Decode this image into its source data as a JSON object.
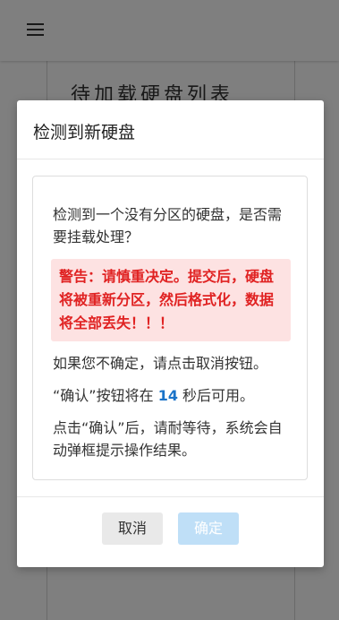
{
  "header": {
    "menu_icon": "hamburger-menu-icon"
  },
  "background": {
    "card_title": "待加载硬盘列表"
  },
  "modal": {
    "title": "检测到新硬盘",
    "message": "检测到一个没有分区的硬盘，是否需要挂载处理？",
    "warning": "警告：请慎重决定。提交后，硬盘将被重新分区，然后格式化，数据将全部丢失！！！",
    "hint_cancel": "如果您不确定，请点击取消按钮。",
    "countdown_prefix": "“确认”按钮将在",
    "countdown_value": "14",
    "countdown_suffix": "秒后可用。",
    "hint_wait": "点击“确认”后，请耐等待，系统会自动弹框提示操作结果。",
    "cancel_label": "取消",
    "confirm_label": "确定"
  },
  "colors": {
    "warning_bg": "#fde2e2",
    "warning_text": "#e02222",
    "countdown": "#1a73c8",
    "confirm_disabled": "#bfdff7"
  }
}
